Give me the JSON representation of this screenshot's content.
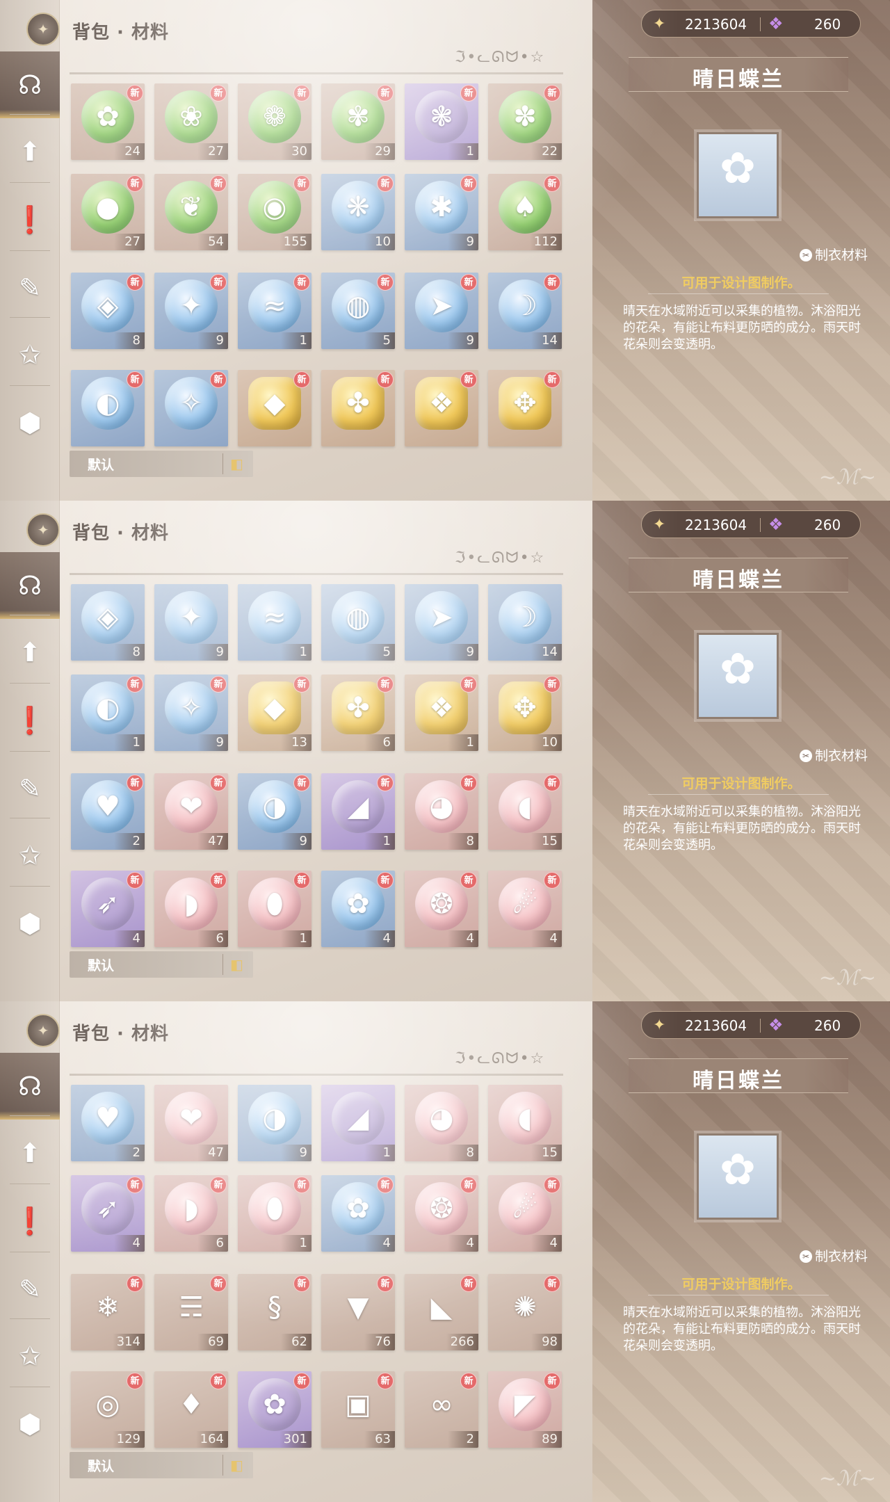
{
  "screens": [
    {
      "title": "背包 · 材料",
      "rune": "ℑ•ᓚᘏᗢ•☆",
      "sort_label": "默认",
      "currency": {
        "gold": "2213604",
        "gem": "260"
      },
      "detail": {
        "name": "晴日蝶兰",
        "category": "制衣材料",
        "usage": "可用于设计图制作。",
        "description": "晴天在水域附近可以采集的植物。沐浴阳光的花朵，有能让布料更防晒的成分。雨天时花朵则会变透明。"
      },
      "rows": [
        [
          {
            "q": "green",
            "g": "✿",
            "c": "24",
            "n": true
          },
          {
            "q": "green",
            "g": "❀",
            "c": "27",
            "n": true
          },
          {
            "q": "green",
            "g": "❁",
            "c": "30",
            "n": true
          },
          {
            "q": "green",
            "g": "✾",
            "c": "29",
            "n": true
          },
          {
            "q": "purple",
            "g": "❃",
            "c": "1",
            "n": true
          },
          {
            "q": "green",
            "g": "✽",
            "c": "22",
            "n": true
          }
        ],
        [
          {
            "q": "green",
            "g": "●",
            "c": "27",
            "n": true
          },
          {
            "q": "green",
            "g": "❦",
            "c": "54",
            "n": true
          },
          {
            "q": "green",
            "g": "◉",
            "c": "155",
            "n": true
          },
          {
            "q": "blue",
            "g": "❋",
            "c": "10",
            "n": true
          },
          {
            "q": "blue",
            "g": "✱",
            "c": "9",
            "n": true
          },
          {
            "q": "green",
            "g": "♠",
            "c": "112",
            "n": true
          }
        ],
        [
          {
            "q": "blue",
            "g": "◈",
            "c": "8",
            "n": true
          },
          {
            "q": "blue",
            "g": "✦",
            "c": "9",
            "n": true
          },
          {
            "q": "blue",
            "g": "≈",
            "c": "1",
            "n": true
          },
          {
            "q": "blue",
            "g": "◍",
            "c": "5",
            "n": true
          },
          {
            "q": "blue",
            "g": "➤",
            "c": "9",
            "n": true
          },
          {
            "q": "blue",
            "g": "☽",
            "c": "14",
            "n": true
          }
        ],
        [
          {
            "q": "blue",
            "g": "◐",
            "c": "",
            "n": true
          },
          {
            "q": "blue",
            "g": "✧",
            "c": "",
            "n": true
          },
          {
            "q": "gold",
            "g": "◆",
            "c": "",
            "n": true
          },
          {
            "q": "gold",
            "g": "✤",
            "c": "",
            "n": true
          },
          {
            "q": "gold",
            "g": "❖",
            "c": "",
            "n": true
          },
          {
            "q": "gold",
            "g": "✥",
            "c": "",
            "n": true
          }
        ]
      ]
    },
    {
      "title": "背包 · 材料",
      "rune": "ℑ•ᓚᘏᗢ•☆",
      "sort_label": "默认",
      "currency": {
        "gold": "2213604",
        "gem": "260"
      },
      "detail": {
        "name": "晴日蝶兰",
        "category": "制衣材料",
        "usage": "可用于设计图制作。",
        "description": "晴天在水域附近可以采集的植物。沐浴阳光的花朵，有能让布料更防晒的成分。雨天时花朵则会变透明。"
      },
      "rows": [
        [
          {
            "q": "blue",
            "g": "◈",
            "c": "8",
            "n": false
          },
          {
            "q": "blue",
            "g": "✦",
            "c": "9",
            "n": false
          },
          {
            "q": "blue",
            "g": "≈",
            "c": "1",
            "n": false
          },
          {
            "q": "blue",
            "g": "◍",
            "c": "5",
            "n": false
          },
          {
            "q": "blue",
            "g": "➤",
            "c": "9",
            "n": false
          },
          {
            "q": "blue",
            "g": "☽",
            "c": "14",
            "n": false
          }
        ],
        [
          {
            "q": "blue",
            "g": "◐",
            "c": "1",
            "n": true
          },
          {
            "q": "blue",
            "g": "✧",
            "c": "9",
            "n": true
          },
          {
            "q": "gold",
            "g": "◆",
            "c": "13",
            "n": true
          },
          {
            "q": "gold",
            "g": "✤",
            "c": "6",
            "n": true
          },
          {
            "q": "gold",
            "g": "❖",
            "c": "1",
            "n": true
          },
          {
            "q": "gold",
            "g": "✥",
            "c": "10",
            "n": true
          }
        ],
        [
          {
            "q": "blue",
            "g": "♥",
            "c": "2",
            "n": true
          },
          {
            "q": "pink",
            "g": "❤",
            "c": "47",
            "n": true
          },
          {
            "q": "blue",
            "g": "◑",
            "c": "9",
            "n": true
          },
          {
            "q": "purple",
            "g": "◢",
            "c": "1",
            "n": true
          },
          {
            "q": "pink",
            "g": "◕",
            "c": "8",
            "n": true
          },
          {
            "q": "pink",
            "g": "◖",
            "c": "15",
            "n": true
          }
        ],
        [
          {
            "q": "purple",
            "g": "➶",
            "c": "4",
            "n": true
          },
          {
            "q": "pink",
            "g": "◗",
            "c": "6",
            "n": true
          },
          {
            "q": "pink",
            "g": "⬮",
            "c": "1",
            "n": true
          },
          {
            "q": "blue",
            "g": "✿",
            "c": "4",
            "n": true
          },
          {
            "q": "pink",
            "g": "❂",
            "c": "4",
            "n": true
          },
          {
            "q": "pink",
            "g": "☄",
            "c": "4",
            "n": true
          }
        ]
      ]
    },
    {
      "title": "背包 · 材料",
      "rune": "ℑ•ᓚᘏᗢ•☆",
      "sort_label": "默认",
      "currency": {
        "gold": "2213604",
        "gem": "260"
      },
      "detail": {
        "name": "晴日蝶兰",
        "category": "制衣材料",
        "usage": "可用于设计图制作。",
        "description": "晴天在水域附近可以采集的植物。沐浴阳光的花朵，有能让布料更防晒的成分。雨天时花朵则会变透明。"
      },
      "rows": [
        [
          {
            "q": "blue",
            "g": "♥",
            "c": "2",
            "n": false
          },
          {
            "q": "pink",
            "g": "❤",
            "c": "47",
            "n": false
          },
          {
            "q": "blue",
            "g": "◑",
            "c": "9",
            "n": false
          },
          {
            "q": "purple",
            "g": "◢",
            "c": "1",
            "n": false
          },
          {
            "q": "pink",
            "g": "◕",
            "c": "8",
            "n": false
          },
          {
            "q": "pink",
            "g": "◖",
            "c": "15",
            "n": false
          }
        ],
        [
          {
            "q": "purple",
            "g": "➶",
            "c": "4",
            "n": true
          },
          {
            "q": "pink",
            "g": "◗",
            "c": "6",
            "n": true
          },
          {
            "q": "pink",
            "g": "⬮",
            "c": "1",
            "n": true
          },
          {
            "q": "blue",
            "g": "✿",
            "c": "4",
            "n": true
          },
          {
            "q": "pink",
            "g": "❂",
            "c": "4",
            "n": true
          },
          {
            "q": "pink",
            "g": "☄",
            "c": "4",
            "n": true
          }
        ],
        [
          {
            "q": "cloth",
            "g": "❄",
            "c": "314",
            "n": true
          },
          {
            "q": "cloth",
            "g": "☴",
            "c": "69",
            "n": true
          },
          {
            "q": "cloth",
            "g": "§",
            "c": "62",
            "n": true
          },
          {
            "q": "cloth",
            "g": "▼",
            "c": "76",
            "n": true
          },
          {
            "q": "cloth",
            "g": "◣",
            "c": "266",
            "n": true
          },
          {
            "q": "cloth",
            "g": "✺",
            "c": "98",
            "n": true
          }
        ],
        [
          {
            "q": "cloth",
            "g": "◎",
            "c": "129",
            "n": true
          },
          {
            "q": "cloth",
            "g": "♦",
            "c": "164",
            "n": true
          },
          {
            "q": "purple",
            "g": "✿",
            "c": "301",
            "n": true
          },
          {
            "q": "cloth",
            "g": "▣",
            "c": "63",
            "n": true
          },
          {
            "q": "cloth",
            "g": "∞",
            "c": "2",
            "n": true
          },
          {
            "q": "pink",
            "g": "◤",
            "c": "89",
            "n": true
          }
        ]
      ]
    }
  ],
  "new_badge": "新",
  "rail_icons": [
    "material-icon",
    "upgrade-icon",
    "quest-icon",
    "crystal-icon",
    "favorite-icon",
    "box-icon"
  ]
}
